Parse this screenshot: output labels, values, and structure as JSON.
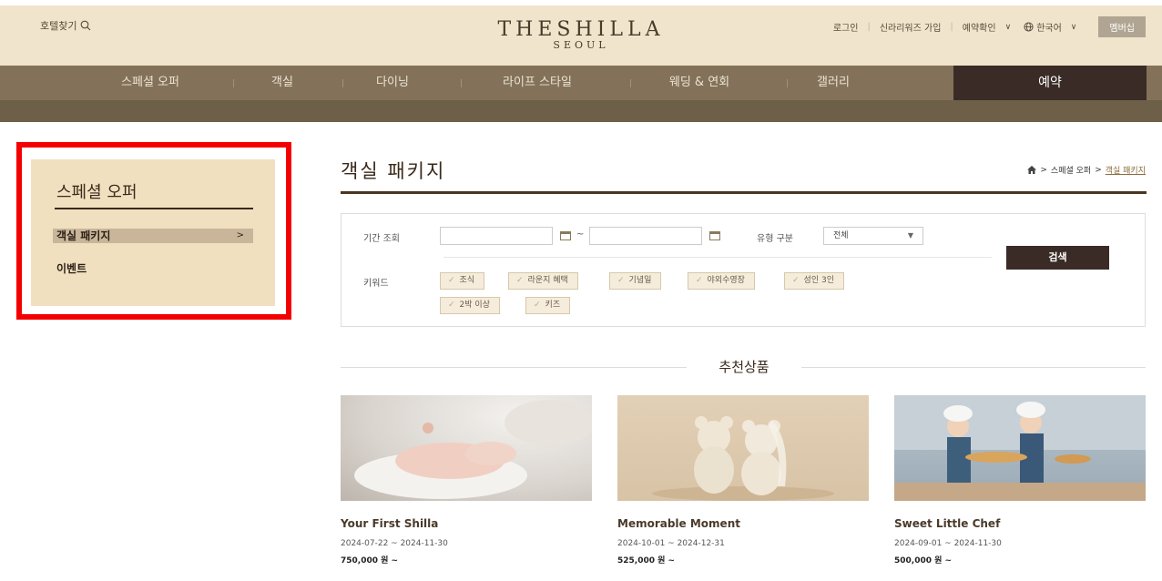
{
  "header": {
    "hotel_find": "호텔찾기",
    "logo_main": "THESHILLA",
    "logo_sub": "SEOUL",
    "login": "로그인",
    "join": "신라리워즈 가입",
    "reservation_check": "예약확인",
    "language": "한국어",
    "membership": "멤버십"
  },
  "gnb": {
    "items": [
      "스페셜 오퍼",
      "객실",
      "다이닝",
      "라이프 스타일",
      "웨딩 & 연회",
      "갤러리"
    ],
    "reserve": "예약"
  },
  "lnb": {
    "title": "스페셜 오퍼",
    "items": [
      {
        "label": "객실 패키지",
        "arrow": ">"
      },
      {
        "label": "이벤트"
      }
    ]
  },
  "page": {
    "title": "객실 패키지",
    "breadcrumb": {
      "sep1": ">",
      "parent": "스페셜 오퍼",
      "sep2": ">",
      "current": "객실 패키지"
    }
  },
  "search": {
    "period_label": "기간 조회",
    "tilde": "~",
    "type_label": "유형 구분",
    "type_value": "전체",
    "keyword_label": "키워드",
    "keywords": [
      "조식",
      "라운지 혜택",
      "기념일",
      "야외수영장",
      "성인 3인",
      "2박 이상",
      "키즈"
    ],
    "search_button": "검색"
  },
  "recommend": {
    "title": "추천상품",
    "cards": [
      {
        "name": "Your First Shilla",
        "period": "2024-07-22 ~ 2024-11-30",
        "price": "750,000 원 ~"
      },
      {
        "name": "Memorable Moment",
        "period": "2024-10-01 ~ 2024-12-31",
        "price": "525,000 원 ~"
      },
      {
        "name": "Sweet Little Chef",
        "period": "2024-09-01 ~ 2024-11-30",
        "price": "500,000 원 ~"
      }
    ]
  },
  "colors": {
    "gnb": "#837259",
    "dark": "#3a2b26",
    "beige": "#f1e0c0",
    "highlight": "#f40000"
  }
}
